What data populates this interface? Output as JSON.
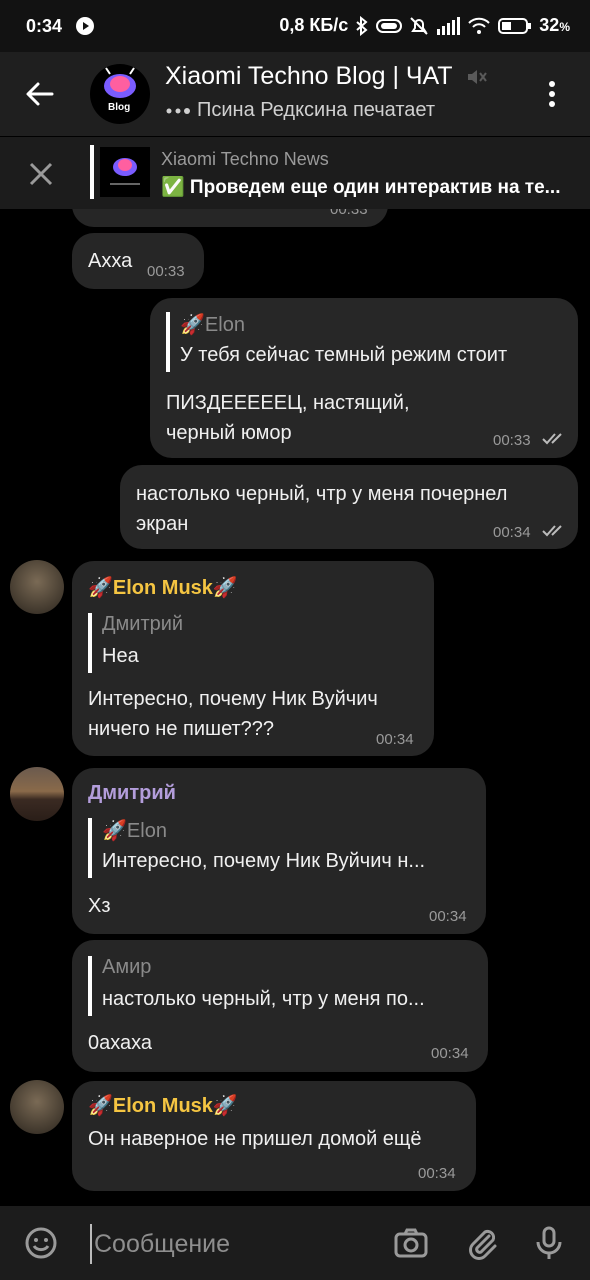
{
  "status_bar": {
    "time": "0:34",
    "net_speed": "0,8 КБ/с",
    "battery": "32",
    "battery_unit": "%"
  },
  "header": {
    "title": "Xiaomi Techno Blog | ЧАТ",
    "subtitle": "Псина Редксина печатает",
    "avatar_text": "Blog"
  },
  "pinned": {
    "channel": "Xiaomi Techno News",
    "text": "✅ Проведем еще один интерактив на те..."
  },
  "messages": [
    {
      "text": "Ахха",
      "time": "00:33"
    },
    {
      "quote_name": "Elon",
      "quote_text": "У тебя сейчас темный режим стоит",
      "text_line1": "ПИЗДЕЕЕЕЕЦ, настящий,",
      "text_line2": "черный юмор",
      "time": "00:33"
    },
    {
      "text_line1": "настолько черный, чтр у меня почернел",
      "text_line2": "экран",
      "time": "00:34"
    },
    {
      "sender": "Elon Musk",
      "quote_name": "Дмитрий",
      "quote_text": "Неа",
      "text_line1": "Интересно, почему Ник Вуйчич",
      "text_line2": "ничего не пишет???",
      "time": "00:34"
    },
    {
      "sender": "Дмитрий",
      "quote_name": "Elon",
      "quote_text": "Интересно, почему Ник Вуйчич н...",
      "text": "Хз",
      "time": "00:34"
    },
    {
      "quote_name": "Амир",
      "quote_text": "настолько черный, чтр у меня по...",
      "text": "0ахаха",
      "time": "00:34"
    },
    {
      "sender": "Elon Musk",
      "text": "Он наверное не пришел домой ещё",
      "time": "00:34"
    }
  ],
  "input": {
    "placeholder": "Сообщение"
  },
  "colors": {
    "elon_name": "#f5c542",
    "dmitry_name": "#b39ddb"
  }
}
